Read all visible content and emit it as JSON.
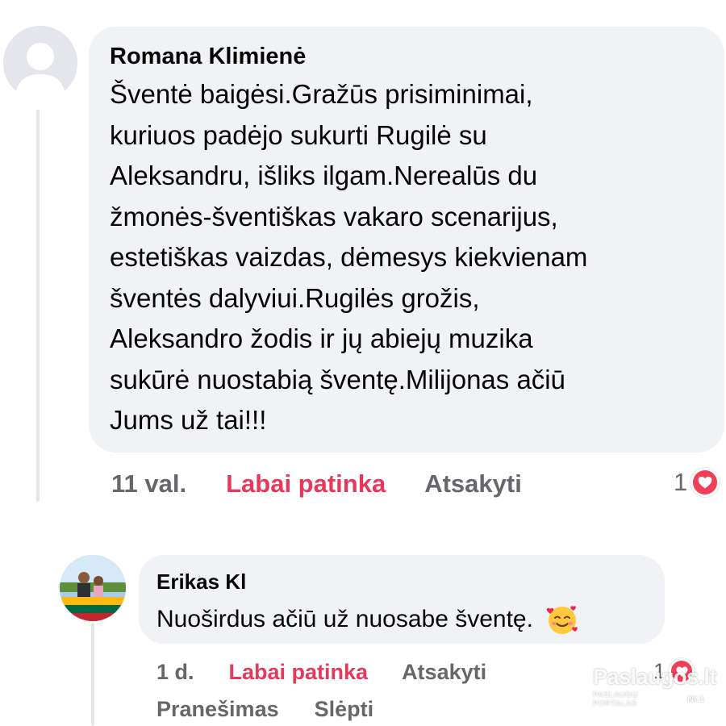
{
  "comments": [
    {
      "author": "Romana Klimienė",
      "text": "Šventė baigėsi.Gražūs prisiminimai,\nkuriuos padėjo sukurti Rugilė su\nAleksandru, išliks ilgam.Nerealūs du\nžmonės-šventiškas vakaro scenarijus,\nestetiškas vaizdas, dėmesys kiekvienam\nšventės dalyviui.Rugilės grožis,\nAleksandro žodis ir jų abiejų muzika\nsukūrė nuostabią šventę.Milijonas ačiū\nJums už tai!!!",
      "time": "11 val.",
      "like_label": "Labai patinka",
      "reply_label": "Atsakyti",
      "reaction_count": "1",
      "reaction_icon": "heart-icon",
      "avatar_icon": "default-profile-icon"
    },
    {
      "author": "Erikas Kl",
      "text": "Nuoširdus ačiū už nuosabe šventę.",
      "emoji_icon": "smiling-face-with-hearts-icon",
      "time": "1 d.",
      "like_label": "Labai patinka",
      "reply_label": "Atsakyti",
      "report_label": "Pranešimas",
      "hide_label": "Slėpti",
      "reaction_count": "1",
      "reaction_icon": "heart-icon"
    }
  ],
  "watermark": {
    "brand": "Paslaugos.lt",
    "subtitle": "PASLAUGŲ PORTALAS",
    "badge": "Nr.1"
  },
  "colors": {
    "bubble": "#f0f2f5",
    "like_active": "#e4395b",
    "secondary_text": "#65676b",
    "heart": "#f33e58"
  }
}
